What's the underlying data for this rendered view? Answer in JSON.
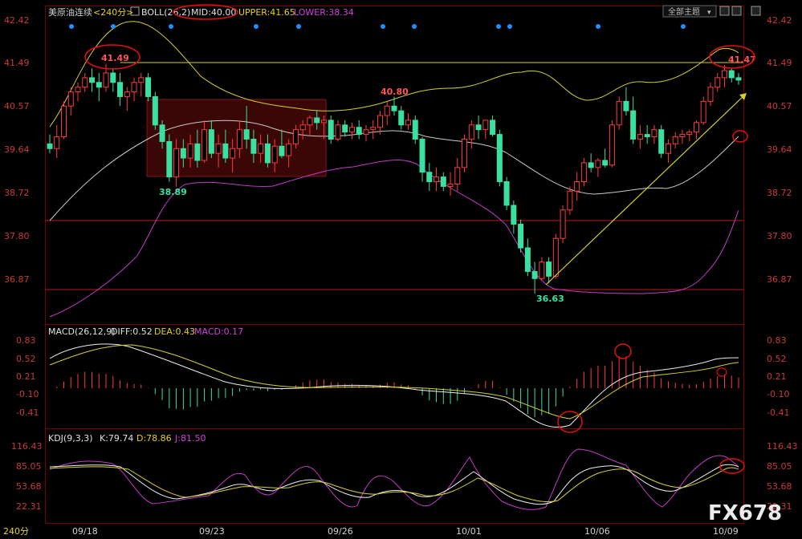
{
  "toolbar": {
    "symbol": "美原油连续",
    "period": "<240分>",
    "boll_label": "BOLL(26,2)",
    "mid": "MID:40.00",
    "upper": "UPPER:41.65",
    "lower": "LOWER:38.34",
    "theme_button": "全部主题",
    "theme_arrow": "▾"
  },
  "colors": {
    "up": "#ff3b3b",
    "down": "#3ae0a0",
    "upper": "#d6d02a",
    "mid": "#cccccc",
    "lower": "#c23bc8",
    "grid": "#7a0000",
    "axis_text": "#c83a3a",
    "box": "#5a1010",
    "dot": "#1e90ff"
  },
  "axis": {
    "price_ticks": [
      "42.42",
      "41.49",
      "40.57",
      "39.64",
      "38.72",
      "37.80",
      "36.87"
    ],
    "macd_ticks": [
      "0.83",
      "0.52",
      "0.21",
      "-0.10",
      "-0.41"
    ],
    "kdj_ticks": [
      "116.43",
      "85.05",
      "53.68",
      "22.31"
    ],
    "x_labels": [
      "09/18",
      "09/23",
      "09/26",
      "10/01",
      "10/06",
      "10/09"
    ],
    "period_corner": "240分"
  },
  "annotations": {
    "high1": "41.49",
    "high2": "40.80",
    "low1": "38.89",
    "low2": "36.63",
    "high3": "41.47"
  },
  "macd_header": {
    "title": "MACD(26,12,9)",
    "diff": "DIFF:0.52",
    "dea": "DEA:0.43",
    "macd": "MACD:0.17"
  },
  "kdj_header": {
    "title": "KDJ(9,3,3)",
    "k": "K:79.74",
    "d": "D:78.86",
    "j": "J:81.50"
  },
  "watermark": "FX678",
  "chart_data": {
    "type": "candlestick",
    "ylim": [
      36.5,
      42.6
    ],
    "reference_lines": [
      41.45,
      38.15,
      36.73
    ],
    "candles": [
      [
        39.8,
        40.0,
        39.6,
        39.7
      ],
      [
        39.7,
        40.2,
        39.5,
        39.95
      ],
      [
        39.95,
        40.7,
        39.9,
        40.6
      ],
      [
        40.6,
        41.0,
        40.4,
        40.9
      ],
      [
        40.9,
        41.1,
        40.7,
        41.0
      ],
      [
        41.0,
        41.3,
        40.9,
        41.2
      ],
      [
        41.2,
        41.4,
        40.9,
        41.1
      ],
      [
        41.1,
        41.3,
        40.7,
        41.0
      ],
      [
        41.0,
        41.49,
        40.9,
        41.3
      ],
      [
        41.3,
        41.4,
        40.9,
        41.1
      ],
      [
        41.1,
        41.3,
        40.6,
        40.8
      ],
      [
        40.8,
        41.0,
        40.5,
        40.9
      ],
      [
        40.9,
        41.2,
        40.7,
        41.1
      ],
      [
        41.1,
        41.3,
        40.8,
        41.2
      ],
      [
        41.2,
        41.3,
        40.7,
        40.8
      ],
      [
        40.8,
        40.9,
        40.1,
        40.2
      ],
      [
        40.2,
        40.3,
        39.7,
        39.85
      ],
      [
        39.85,
        40.0,
        39.0,
        39.1
      ],
      [
        39.1,
        39.9,
        38.89,
        39.7
      ],
      [
        39.7,
        39.9,
        39.3,
        39.5
      ],
      [
        39.5,
        40.0,
        39.3,
        39.8
      ],
      [
        39.8,
        40.1,
        39.3,
        39.45
      ],
      [
        39.45,
        40.3,
        39.4,
        40.1
      ],
      [
        40.1,
        40.3,
        39.5,
        39.6
      ],
      [
        39.6,
        40.0,
        39.3,
        39.8
      ],
      [
        39.8,
        40.1,
        39.4,
        39.5
      ],
      [
        39.5,
        39.9,
        39.2,
        39.7
      ],
      [
        39.7,
        40.3,
        39.5,
        40.1
      ],
      [
        40.1,
        40.6,
        39.7,
        39.9
      ],
      [
        39.9,
        40.1,
        39.4,
        39.6
      ],
      [
        39.6,
        40.0,
        39.4,
        39.8
      ],
      [
        39.8,
        40.0,
        39.3,
        39.4
      ],
      [
        39.4,
        39.9,
        39.2,
        39.75
      ],
      [
        39.75,
        40.1,
        39.5,
        39.55
      ],
      [
        39.55,
        39.9,
        39.3,
        39.8
      ],
      [
        39.8,
        40.2,
        39.7,
        40.1
      ],
      [
        40.1,
        40.3,
        39.9,
        40.2
      ],
      [
        40.2,
        40.4,
        40.0,
        40.35
      ],
      [
        40.35,
        40.5,
        40.1,
        40.25
      ],
      [
        40.25,
        40.4,
        39.9,
        40.3
      ],
      [
        40.3,
        40.4,
        39.8,
        39.9
      ],
      [
        39.9,
        40.3,
        39.85,
        40.2
      ],
      [
        40.2,
        40.3,
        39.95,
        40.05
      ],
      [
        40.05,
        40.25,
        39.9,
        40.15
      ],
      [
        40.15,
        40.3,
        39.9,
        40.0
      ],
      [
        40.0,
        40.2,
        39.85,
        40.1
      ],
      [
        40.1,
        40.3,
        39.9,
        40.15
      ],
      [
        40.15,
        40.5,
        40.0,
        40.4
      ],
      [
        40.4,
        40.7,
        40.2,
        40.6
      ],
      [
        40.6,
        40.8,
        40.4,
        40.5
      ],
      [
        40.5,
        40.6,
        40.1,
        40.2
      ],
      [
        40.2,
        40.45,
        40.1,
        40.3
      ],
      [
        40.3,
        40.4,
        39.8,
        39.9
      ],
      [
        39.9,
        39.95,
        39.0,
        39.2
      ],
      [
        39.2,
        39.4,
        38.8,
        39.0
      ],
      [
        39.0,
        39.3,
        38.8,
        39.1
      ],
      [
        39.1,
        39.2,
        38.8,
        38.9
      ],
      [
        38.9,
        39.2,
        38.7,
        38.95
      ],
      [
        38.95,
        39.5,
        38.8,
        39.3
      ],
      [
        39.3,
        40.0,
        39.2,
        39.9
      ],
      [
        39.9,
        40.3,
        39.7,
        40.2
      ],
      [
        40.2,
        40.4,
        39.9,
        40.1
      ],
      [
        40.1,
        40.3,
        39.9,
        40.3
      ],
      [
        40.3,
        40.4,
        39.95,
        40.0
      ],
      [
        40.0,
        40.1,
        38.9,
        39.0
      ],
      [
        39.0,
        39.1,
        38.4,
        38.5
      ],
      [
        38.5,
        38.6,
        37.9,
        38.1
      ],
      [
        38.1,
        38.2,
        37.5,
        37.6
      ],
      [
        37.6,
        37.8,
        37.0,
        37.1
      ],
      [
        37.1,
        37.3,
        36.63,
        36.95
      ],
      [
        36.95,
        37.4,
        36.9,
        37.3
      ],
      [
        37.3,
        37.4,
        36.85,
        37.0
      ],
      [
        37.0,
        37.9,
        36.95,
        37.8
      ],
      [
        37.8,
        38.5,
        37.7,
        38.4
      ],
      [
        38.4,
        38.9,
        38.3,
        38.8
      ],
      [
        38.8,
        39.2,
        38.6,
        39.0
      ],
      [
        39.0,
        39.5,
        38.9,
        39.4
      ],
      [
        39.4,
        39.6,
        39.2,
        39.3
      ],
      [
        39.3,
        39.5,
        39.1,
        39.45
      ],
      [
        39.45,
        39.7,
        39.3,
        39.35
      ],
      [
        39.35,
        40.3,
        39.3,
        40.2
      ],
      [
        40.2,
        40.8,
        40.1,
        40.7
      ],
      [
        40.7,
        41.0,
        40.4,
        40.5
      ],
      [
        40.5,
        40.8,
        39.8,
        39.9
      ],
      [
        39.9,
        40.2,
        39.7,
        40.0
      ],
      [
        40.0,
        40.2,
        39.8,
        39.95
      ],
      [
        39.95,
        40.2,
        39.8,
        40.1
      ],
      [
        40.1,
        40.2,
        39.5,
        39.6
      ],
      [
        39.6,
        39.9,
        39.4,
        39.8
      ],
      [
        39.8,
        40.05,
        39.7,
        39.95
      ],
      [
        39.95,
        40.1,
        39.8,
        40.0
      ],
      [
        40.0,
        40.1,
        39.85,
        40.05
      ],
      [
        40.05,
        40.3,
        39.9,
        40.25
      ],
      [
        40.25,
        40.8,
        40.2,
        40.7
      ],
      [
        40.7,
        41.1,
        40.6,
        41.0
      ],
      [
        41.0,
        41.3,
        40.9,
        41.2
      ],
      [
        41.2,
        41.47,
        41.0,
        41.35
      ],
      [
        41.35,
        41.4,
        41.1,
        41.2
      ],
      [
        41.2,
        41.3,
        41.05,
        41.15
      ]
    ]
  }
}
